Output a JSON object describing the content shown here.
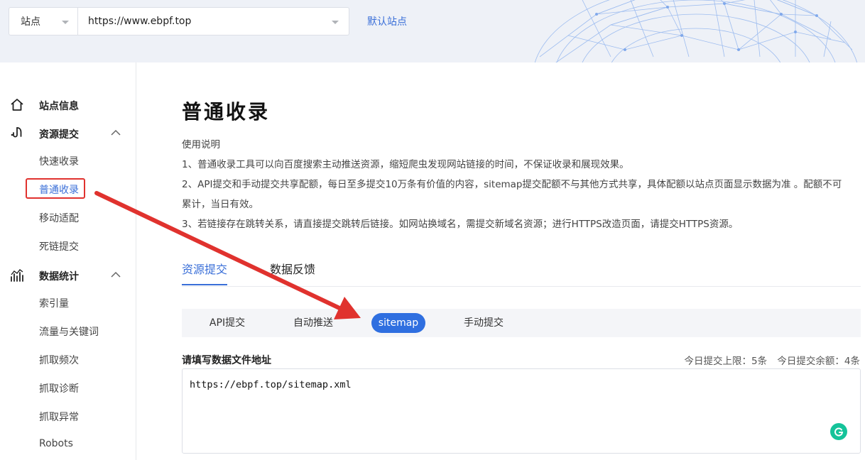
{
  "header": {
    "site_select_label": "站点",
    "url_value": "https://www.ebpf.top",
    "default_site_link": "默认站点"
  },
  "sidebar": {
    "groups": [
      {
        "label": "站点信息",
        "icon": "home-icon"
      },
      {
        "label": "资源提交",
        "icon": "upload-hook-icon",
        "expanded": true,
        "items": [
          "快速收录",
          "普通收录",
          "移动适配",
          "死链提交"
        ]
      },
      {
        "label": "数据统计",
        "icon": "chart-stats-icon",
        "expanded": true,
        "items": [
          "索引量",
          "流量与关键词",
          "抓取频次",
          "抓取诊断",
          "抓取异常",
          "Robots"
        ]
      }
    ],
    "active_item": "普通收录"
  },
  "page": {
    "title": "普通收录",
    "usage_heading": "使用说明",
    "usage_lines": [
      "1、普通收录工具可以向百度搜索主动推送资源，缩短爬虫发现网站链接的时间，不保证收录和展现效果。",
      "2、API提交和手动提交共享配额，每日至多提交10万条有价值的内容，sitemap提交配额不与其他方式共享，具体配额以站点页面显示数据为准 。配额不可",
      "累计，当日有效。",
      "3、若链接存在跳转关系，请直接提交跳转后链接。如网站换域名，需提交新域名资源；进行HTTPS改造页面，请提交HTTPS资源。"
    ],
    "main_tabs": [
      "资源提交",
      "数据反馈"
    ],
    "active_main_tab": "资源提交",
    "sub_tabs": [
      "API提交",
      "自动推送",
      "sitemap",
      "手动提交"
    ],
    "active_sub_tab": "sitemap",
    "field_label": "请填写数据文件地址",
    "quota_limit": "今日提交上限：5条",
    "quota_remaining": "今日提交余额：4条",
    "textarea_value": "https://ebpf.top/sitemap.xml"
  },
  "colors": {
    "accent": "#3a6fd8",
    "active_pill": "#2f6fe0",
    "annotation_red": "#e0322e",
    "grammarly_green": "#15c39a"
  }
}
